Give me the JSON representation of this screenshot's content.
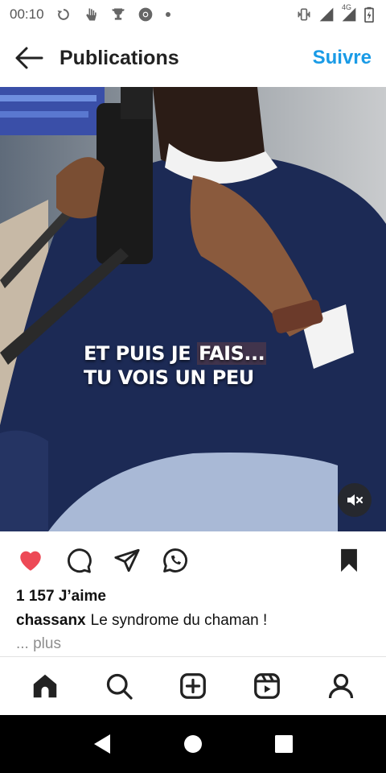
{
  "status_bar": {
    "time": "00:10",
    "network_label": "4G",
    "icons": [
      "refresh-icon",
      "hand-icon",
      "trophy-icon",
      "chrome-icon",
      "dot-icon",
      "vibrate-icon",
      "signal-icon",
      "signal-4g-icon",
      "battery-icon"
    ]
  },
  "header": {
    "title": "Publications",
    "follow_label": "Suivre",
    "accent_color": "#1a9be6"
  },
  "media": {
    "caption_line1_a": "ET PUIS JE ",
    "caption_line1_highlight": "FAIS...",
    "caption_line2": "TU VOIS UN PEU",
    "mute_icon": "volume-mute-icon"
  },
  "actions": {
    "liked": true,
    "like_color": "#ed4956",
    "icons": [
      "heart-icon",
      "comment-icon",
      "share-icon",
      "whatsapp-icon",
      "bookmark-icon"
    ]
  },
  "post": {
    "likes_text": "1 157 J’aime",
    "username": "chassanx",
    "caption": "Le syndrome du chaman !",
    "more_label": "... plus"
  },
  "bottom_nav": {
    "items": [
      "home-icon",
      "search-icon",
      "create-icon",
      "reels-icon",
      "profile-icon"
    ]
  },
  "system_nav": {
    "items": [
      "back-triangle-icon",
      "home-circle-icon",
      "recents-square-icon"
    ]
  }
}
